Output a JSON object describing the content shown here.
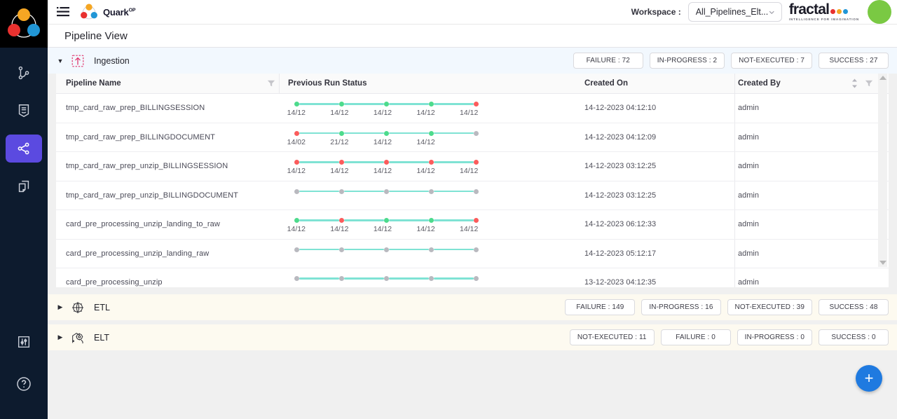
{
  "app": {
    "brand_name": "Quark",
    "brand_sup": "OP",
    "page_title": "Pipeline View",
    "logo_colors": {
      "top": "#f5a623",
      "left": "#e8312f",
      "right": "#2196d6"
    }
  },
  "topbar": {
    "menu_icon": "hamburger-menu-icon",
    "workspace_label": "Workspace :",
    "workspace_value": "All_Pipelines_Elt...",
    "company_name": "fractal",
    "company_tagline": "INTELLIGENCE FOR IMAGINATION",
    "company_dot_colors": [
      "#e8312f",
      "#f5a623",
      "#2196d6"
    ],
    "avatar_color": "#7ac943"
  },
  "sidebar": {
    "items": [
      {
        "name": "pipelines",
        "icon": "git-branch-icon",
        "active": false
      },
      {
        "name": "documents",
        "icon": "document-icon",
        "active": false
      },
      {
        "name": "share",
        "icon": "share-nodes-icon",
        "active": true
      },
      {
        "name": "copies",
        "icon": "copy-pages-icon",
        "active": false
      }
    ],
    "bottom_items": [
      {
        "name": "settings",
        "icon": "sliders-icon"
      },
      {
        "name": "help",
        "icon": "question-circle-icon"
      }
    ],
    "active_color": "#5b4ae0"
  },
  "status_colors": {
    "success": "#4ddb8c",
    "failure": "#fb5c5c",
    "not_executed": "#b9b9bf",
    "link": "#7fe3d4"
  },
  "table": {
    "columns": [
      "Pipeline Name",
      "Previous Run Status",
      "Created On",
      "Created By"
    ],
    "filter_icon": "filter-icon",
    "sort_icon": "sort-updown-icon"
  },
  "groups": [
    {
      "id": "ingestion",
      "label": "Ingestion",
      "icon": "ingestion-upload-icon",
      "expanded": true,
      "caret": "caret-down-icon",
      "badges": [
        {
          "label": "FAILURE : 72"
        },
        {
          "label": "IN-PROGRESS : 2"
        },
        {
          "label": "NOT-EXECUTED : 7"
        },
        {
          "label": "SUCCESS : 27"
        }
      ],
      "rows": [
        {
          "name": "tmp_card_raw_prep_BILLINGSESSION",
          "statuses": [
            "success",
            "success",
            "success",
            "success",
            "failure"
          ],
          "dates": [
            "14/12",
            "14/12",
            "14/12",
            "14/12",
            "14/12"
          ],
          "created_on": "14-12-2023 04:12:10",
          "created_by": "admin"
        },
        {
          "name": "tmp_card_raw_prep_BILLINGDOCUMENT",
          "statuses": [
            "failure",
            "success",
            "success",
            "success",
            "not_executed"
          ],
          "dates": [
            "14/02",
            "21/12",
            "14/12",
            "14/12",
            ""
          ],
          "created_on": "14-12-2023 04:12:09",
          "created_by": "admin"
        },
        {
          "name": "tmp_card_raw_prep_unzip_BILLINGSESSION",
          "statuses": [
            "failure",
            "failure",
            "failure",
            "failure",
            "failure"
          ],
          "dates": [
            "14/12",
            "14/12",
            "14/12",
            "14/12",
            "14/12"
          ],
          "created_on": "14-12-2023 03:12:25",
          "created_by": "admin"
        },
        {
          "name": "tmp_card_raw_prep_unzip_BILLINGDOCUMENT",
          "statuses": [
            "not_executed",
            "not_executed",
            "not_executed",
            "not_executed",
            "not_executed"
          ],
          "dates": [
            "",
            "",
            "",
            "",
            ""
          ],
          "created_on": "14-12-2023 03:12:25",
          "created_by": "admin"
        },
        {
          "name": "card_pre_processing_unzip_landing_to_raw",
          "statuses": [
            "success",
            "failure",
            "success",
            "success",
            "failure"
          ],
          "dates": [
            "14/12",
            "14/12",
            "14/12",
            "14/12",
            "14/12"
          ],
          "created_on": "14-12-2023 06:12:33",
          "created_by": "admin"
        },
        {
          "name": "card_pre_processing_unzip_landing_raw",
          "statuses": [
            "not_executed",
            "not_executed",
            "not_executed",
            "not_executed",
            "not_executed"
          ],
          "dates": [
            "",
            "",
            "",
            "",
            ""
          ],
          "created_on": "14-12-2023 05:12:17",
          "created_by": "admin"
        },
        {
          "name": "card_pre_processing_unzip",
          "statuses": [
            "not_executed",
            "not_executed",
            "not_executed",
            "not_executed",
            "not_executed"
          ],
          "dates": [
            "",
            "",
            "",
            "",
            ""
          ],
          "created_on": "13-12-2023 04:12:35",
          "created_by": "admin"
        }
      ]
    },
    {
      "id": "etl",
      "label": "ETL",
      "icon": "etl-gear-globe-icon",
      "expanded": false,
      "caret": "caret-right-icon",
      "badges": [
        {
          "label": "FAILURE : 149"
        },
        {
          "label": "IN-PROGRESS : 16"
        },
        {
          "label": "NOT-EXECUTED : 39"
        },
        {
          "label": "SUCCESS : 48"
        }
      ],
      "rows": []
    },
    {
      "id": "elt",
      "label": "ELT",
      "icon": "elt-gear-icon",
      "expanded": false,
      "caret": "caret-right-icon",
      "badges": [
        {
          "label": "NOT-EXECUTED : 11"
        },
        {
          "label": "FAILURE : 0"
        },
        {
          "label": "IN-PROGRESS : 0"
        },
        {
          "label": "SUCCESS : 0"
        }
      ],
      "rows": []
    }
  ],
  "fab": {
    "label": "+",
    "color": "#1f7ae0"
  }
}
